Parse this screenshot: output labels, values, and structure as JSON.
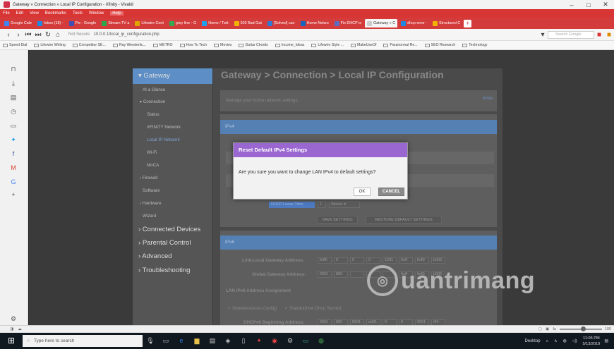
{
  "window": {
    "title": "Gateway » Connection » Local IP Configuration - Xfinity - Vivaldi"
  },
  "menu": [
    "File",
    "Edit",
    "View",
    "Bookmarks",
    "Tools",
    "Window",
    "Help"
  ],
  "tabs": [
    {
      "label": "Google Cale",
      "color": "#4285f4"
    },
    {
      "label": "Inbox (18) -",
      "color": "#1e88e5"
    },
    {
      "label": "Pw - Google",
      "color": "#3f51b5"
    },
    {
      "label": "Stream TV a",
      "color": "#2aa84a"
    },
    {
      "label": "Lifewire Cont",
      "color": "#e0a400"
    },
    {
      "label": "grey line - G",
      "color": "#34a853"
    },
    {
      "label": "Home / Twit",
      "color": "#1da1f2"
    },
    {
      "label": "502 Bad Gat",
      "color": "#f0b400"
    },
    {
      "label": "[Solved] can",
      "color": "#2d7bd6"
    },
    {
      "label": "Home Netwo",
      "color": "#1565c0"
    },
    {
      "label": "Fix DHCP is",
      "color": "#5c6bc0"
    },
    {
      "label": "Gateway » C",
      "color": "#cccccc",
      "active": true
    },
    {
      "label": "dhcp error -",
      "color": "#1e88e5"
    },
    {
      "label": "Structured C",
      "color": "#f0b400"
    }
  ],
  "address": {
    "security": "Not Secure",
    "url": "10.0.0.1/local_ip_configuration.php",
    "search_placeholder": "Search Google"
  },
  "bookmarks": [
    "Speed Dial",
    "Lifewire Writing",
    "Competitor SE...",
    "Ray Wenderlic...",
    "METRO",
    "How To Tech",
    "Movies",
    "Guitar Chords",
    "Income_Ideas",
    "Lifewire Style ...",
    "MakeUseOf",
    "Paranormal Re...",
    "SEO Research",
    "Technology"
  ],
  "gateway_nav": {
    "gateway": "Gateway",
    "at_a_glance": "At a Glance",
    "connection": "Connection",
    "status": "Status",
    "xfinity_network": "XFINITY Network",
    "local_ip_network": "Local IP Network",
    "wifi": "Wi-Fi",
    "moca": "MoCA",
    "firewall": "Firewall",
    "software": "Software",
    "hardware": "Hardware",
    "wizard": "Wizard",
    "connected_devices": "Connected Devices",
    "parental_control": "Parental Control",
    "advanced": "Advanced",
    "troubleshooting": "Troubleshooting"
  },
  "content": {
    "heading": "Gateway > Connection > Local IP Configuration",
    "subtitle": "Manage your home network settings.",
    "more": "more",
    "ipv4": "IPv4",
    "dhcp_lease_time": "DHCP Lease Time",
    "lease_value": "1",
    "lease_unit": "Weeks",
    "save_settings": "SAVE SETTINGS",
    "restore_default": "RESTORE DEFAULT SETTINGS",
    "ipv6": "IPv6",
    "link_local_label": "Link-Local Gateway Address:",
    "link_local_values": [
      "fe80",
      "0",
      "0",
      "0",
      "1281",
      "5eff",
      "fe80",
      "b006"
    ],
    "global_label": "Global Gateway Address:",
    "global_values": [
      "2601",
      "805",
      "",
      "",
      "",
      "6eff",
      "fe80",
      "b006"
    ],
    "lan_ipv6": "LAN IPv6 Address Assignment",
    "stateless": "Stateless(Auto-Config)",
    "stateful": "Stateful(Use Dhcp Server)",
    "dhcpv6_label": "DHCPv6 Beginning Address:",
    "dhcpv6_values": [
      "2601",
      "805",
      "8301",
      "ed01",
      "0",
      "0",
      "0001",
      "/64"
    ]
  },
  "dialog": {
    "title": "Reset Default IPv4 Settings",
    "message": "Are you sure you want to change LAN IPv4 to default settings?",
    "ok": "OK",
    "cancel": "CANCEL"
  },
  "watermark": {
    "text": "uantrimang"
  },
  "statusbar": {
    "zoom": "100"
  },
  "taskbar": {
    "search_placeholder": "Type here to search",
    "desktop": "Desktop",
    "time": "11:05 PM",
    "date": "5/13/2019"
  }
}
